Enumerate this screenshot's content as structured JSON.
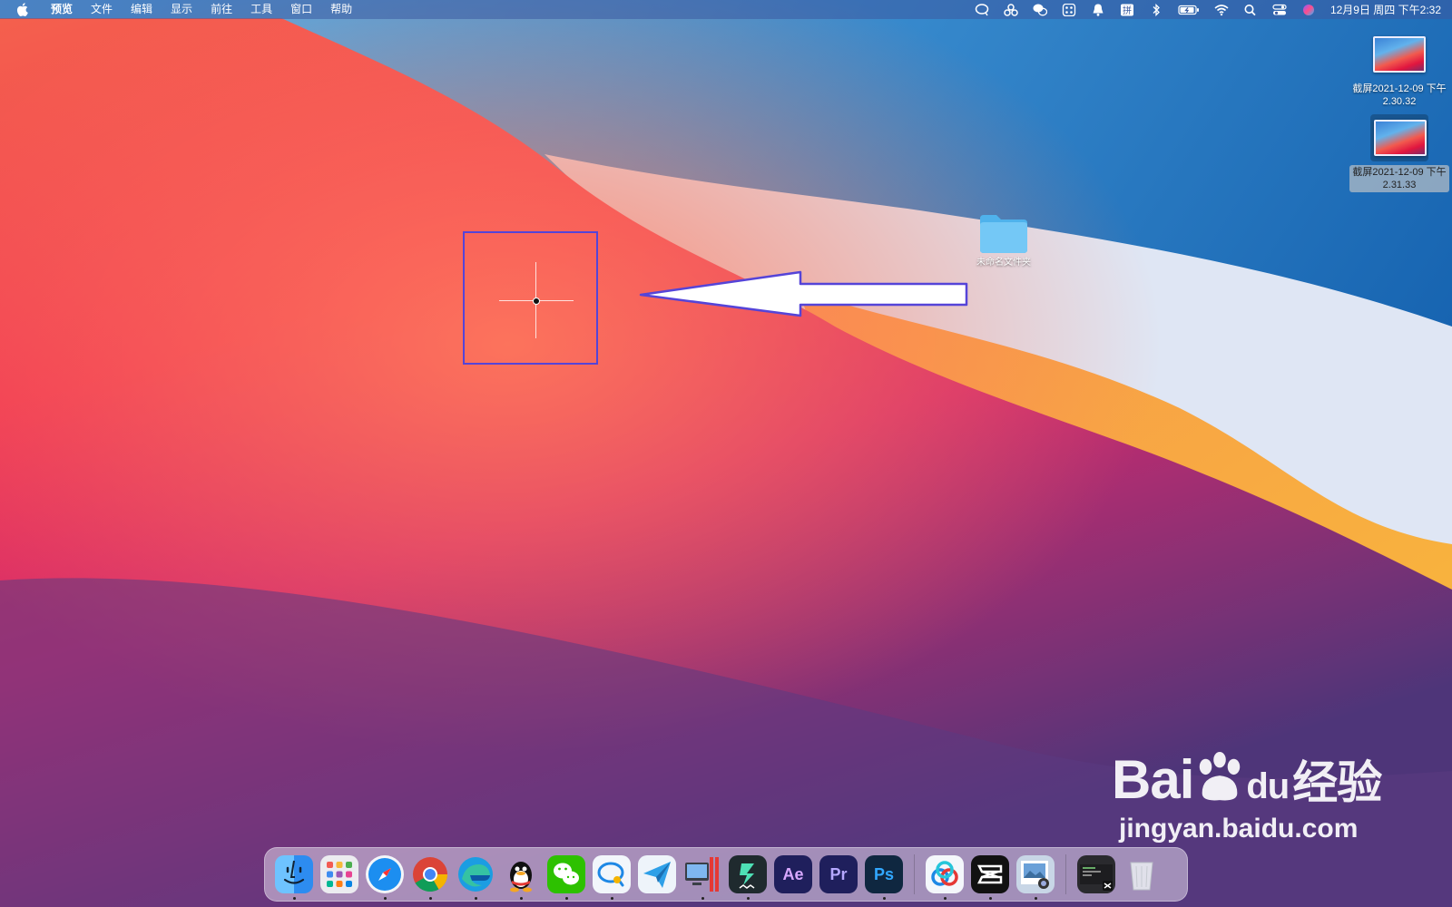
{
  "menubar": {
    "app_name": "预览",
    "items": [
      "文件",
      "编辑",
      "显示",
      "前往",
      "工具",
      "窗口",
      "帮助"
    ],
    "status_icons": [
      "chat-bubble-icon",
      "connection-icon",
      "wechat-icon",
      "grid-icon",
      "bell-icon",
      "input-method-icon",
      "bluetooth-icon",
      "battery-icon",
      "wifi-icon",
      "search-icon",
      "control-center-icon",
      "siri-icon"
    ],
    "input_method_label": "拼",
    "clock": "12月9日 周四 下午2:32"
  },
  "desktop": {
    "files": [
      {
        "label": "截屏2021-12-09 下午2.30.32",
        "selected": false
      },
      {
        "label": "截屏2021-12-09 下午2.31.33",
        "selected": true
      }
    ],
    "folder": {
      "label": "未命名文件夹"
    }
  },
  "dock": {
    "apps": [
      {
        "name": "finder-app",
        "text": "",
        "color": "#2d8cf0",
        "running": true
      },
      {
        "name": "launchpad-app",
        "text": "",
        "color": "#e8e8ec",
        "running": false
      },
      {
        "name": "safari-app",
        "text": "",
        "color": "#1c8ef0",
        "running": true
      },
      {
        "name": "chrome-app",
        "text": "",
        "color": "#f4f4f4",
        "running": true
      },
      {
        "name": "edge-app",
        "text": "",
        "color": "#1a7fd4",
        "running": true
      },
      {
        "name": "qq-app",
        "text": "",
        "color": "transparent",
        "running": true
      },
      {
        "name": "wechat-app",
        "text": "",
        "color": "#2dc100",
        "running": true
      },
      {
        "name": "qq-browser-app",
        "text": "",
        "color": "#f2f6fb",
        "running": true
      },
      {
        "name": "send-app",
        "text": "",
        "color": "#eef4fa",
        "running": false
      },
      {
        "name": "parallels-app",
        "text": "",
        "color": "#d7dbe2",
        "running": true
      },
      {
        "name": "filmora-app",
        "text": "",
        "color": "#1f2a2e",
        "running": true
      },
      {
        "name": "after-effects-app",
        "text": "Ae",
        "color": "#1f1f5c",
        "running": false
      },
      {
        "name": "premiere-app",
        "text": "Pr",
        "color": "#1f1f5c",
        "running": false
      },
      {
        "name": "photoshop-app",
        "text": "Ps",
        "color": "#0f2740",
        "running": true
      },
      {
        "name": "baidu-netdisk-app",
        "text": "",
        "color": "#f4f7fb",
        "running": true
      },
      {
        "name": "capcut-app",
        "text": "",
        "color": "#111111",
        "running": true
      },
      {
        "name": "preview-app",
        "text": "",
        "color": "#c8d6e6",
        "running": true
      },
      {
        "name": "screenshot-folder",
        "text": "",
        "color": "#2a2a2e",
        "running": false
      },
      {
        "name": "trash-app",
        "text": "",
        "color": "#dfe3e8",
        "running": false
      }
    ]
  },
  "watermark": {
    "brand": "Bai",
    "brand_tail": "du",
    "brand_cn": "经验",
    "url": "jingyan.baidu.com"
  },
  "colors": {
    "annotation": "#5544d8",
    "menubar_text": "#ffffff"
  }
}
